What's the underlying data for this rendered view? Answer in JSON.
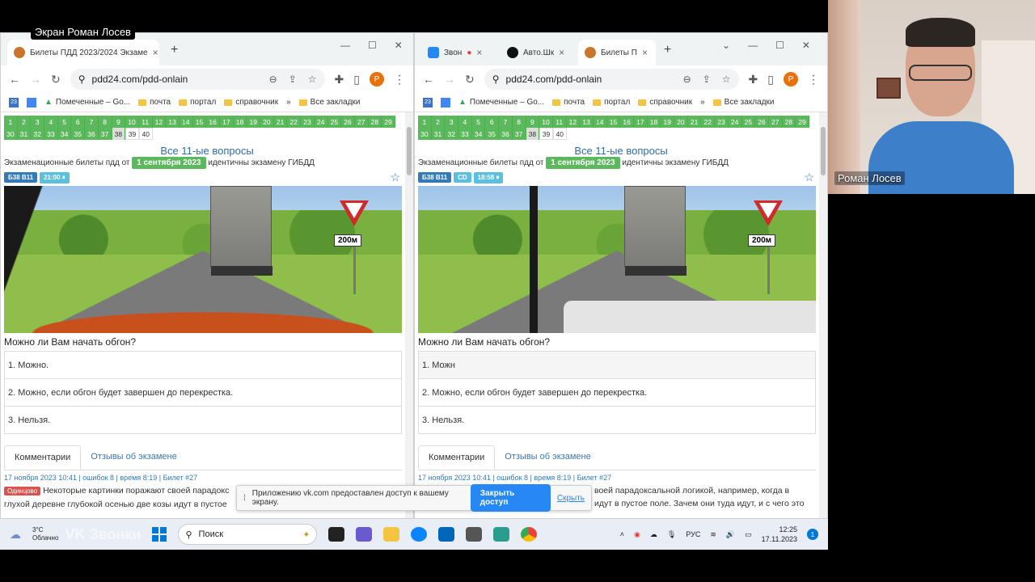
{
  "screen_label": "Экран Роман Лосев",
  "camera_name": "Роман Лосев",
  "left_window": {
    "tab_title": "Билеты ПДД 2023/2024 Экзаме",
    "url": "pdd24.com/pdd-onlain"
  },
  "right_window": {
    "tabs": [
      "Звон",
      "Авто.Шк",
      "Билеты П"
    ],
    "url": "pdd24.com/pdd-onlain"
  },
  "bookmarks": {
    "b1": "Помеченные – Go...",
    "b2": "почта",
    "b3": "портал",
    "b4": "справочник",
    "more": "»",
    "all": "Все закладки",
    "b1_right": "Помеченные – Go..."
  },
  "page": {
    "numbers": [
      "1",
      "2",
      "3",
      "4",
      "5",
      "6",
      "7",
      "8",
      "9",
      "10",
      "11",
      "12",
      "13",
      "14",
      "15",
      "16",
      "17",
      "18",
      "19",
      "20",
      "21",
      "22",
      "23",
      "24",
      "25",
      "26",
      "27",
      "28",
      "29",
      "30",
      "31",
      "32",
      "33",
      "34",
      "35",
      "36",
      "37",
      "38",
      "39",
      "40"
    ],
    "heading": "Все 11-ые вопросы",
    "sub_before": "Экзаменационные билеты пдд от",
    "sub_date": "1 сентября 2023",
    "sub_after": "идентичны экзамену ГИБДД",
    "badge_ticket": "Б38 В11",
    "badge_time_left": "21:00 ⏸",
    "badge_cd": "CD",
    "badge_time_right": "18:58 ⏸",
    "sign_text": "200м",
    "question": "Можно ли Вам начать обгон?",
    "answers": [
      "1. Можно.",
      "2. Можно, если обгон будет завершен до перекрестка.",
      "3. Нельзя."
    ],
    "answer1_right": "1. Можн",
    "tab_comments": "Комментарии",
    "tab_reviews": "Отзывы об экзамене",
    "meta": "17 ноября 2023 10:41 | ошибок 8 | время 8:19 | Билет #27",
    "comment_tag": "Одинцово",
    "comment_left_1": "Некоторые картинки поражают своей парадокс",
    "comment_left_2": "глухой деревне глубокой осенью две козы идут в пустое",
    "comment_right_1": "воей парадоксальной логикой, например, когда в",
    "comment_right_2": "идут в пустое поле. Зачем они туда идут, и с чего это"
  },
  "notice": {
    "text": "Приложению vk.com предоставлен доступ к вашему экрану.",
    "button": "Закрыть доступ",
    "hide": "Скрыть"
  },
  "taskbar": {
    "temp": "3°C",
    "weather": "Облачно",
    "watermark": "VK Звонки",
    "search": "Поиск",
    "lang": "РУС",
    "time": "12:25",
    "date": "17.11.2023",
    "notif": "1"
  },
  "colors": {
    "green": "#5cb85c",
    "link_blue": "#337ab7",
    "vk_blue": "#2787f5"
  }
}
